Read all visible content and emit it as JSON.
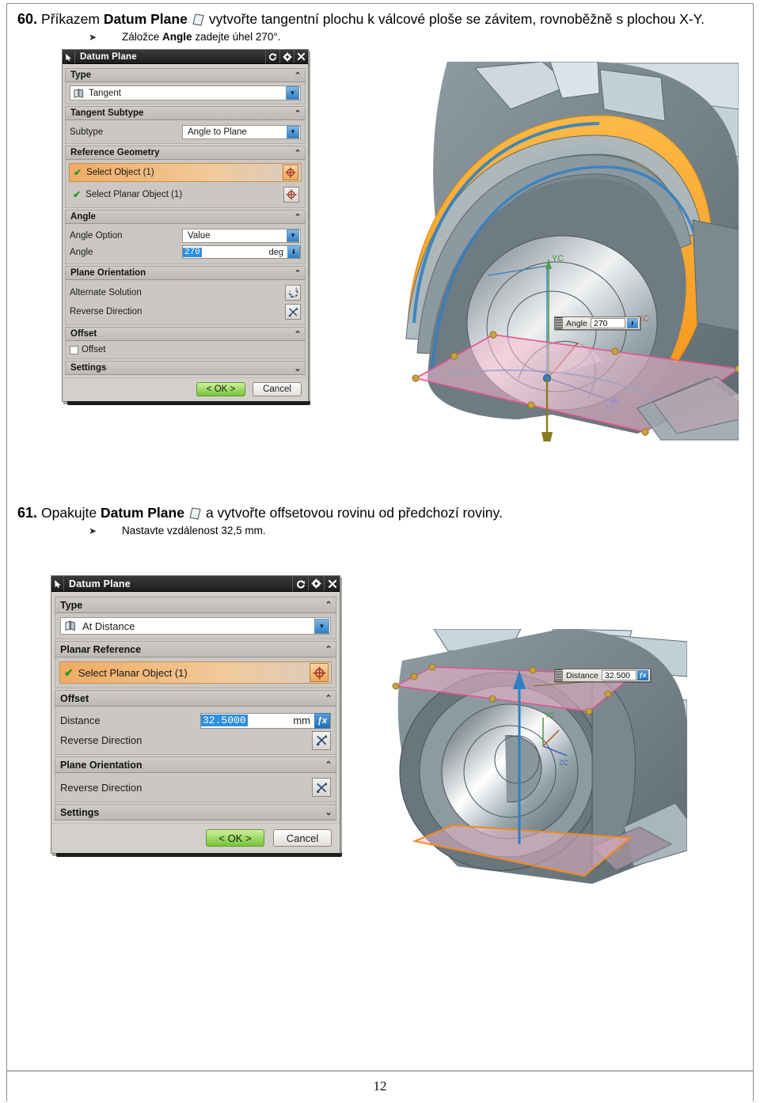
{
  "document": {
    "page_number": "12"
  },
  "steps": [
    {
      "number": "60.",
      "text_before": "Příkazem",
      "command": "Datum Plane",
      "icon": "datum-plane-icon",
      "text_after": "vytvořte tangentní plochu k válcové ploše se závitem, rovnoběžně s plochou X-Y.",
      "sub": {
        "bullet": "➤",
        "before": "Záložce",
        "bold": "Angle",
        "after": "zadejte úhel 270°."
      }
    },
    {
      "number": "61.",
      "text_before": "Opakujte",
      "command": "Datum Plane",
      "icon": "datum-plane-icon",
      "text_after": "a vytvořte offsetovou rovinu od předchozí roviny.",
      "sub": {
        "bullet": "➤",
        "before": "Nastavte vzdálenost 32,5 mm.",
        "bold": "",
        "after": ""
      }
    }
  ],
  "dialog1": {
    "title": "Datum Plane",
    "titlebar_icons": [
      "cursor-icon",
      "reset-icon",
      "gear-icon",
      "close-icon"
    ],
    "groups": [
      {
        "name": "type-group",
        "header": "Type",
        "chevron": "⌃",
        "combo": {
          "label": "Tangent",
          "icon": "plane-icon",
          "arrow": "▼"
        }
      },
      {
        "name": "tangent-subtype-group",
        "header": "Tangent Subtype",
        "chevron": "⌃",
        "row_label": "Subtype",
        "combo": {
          "label": "Angle to Plane",
          "arrow": "▼"
        }
      },
      {
        "name": "reference-geometry-group",
        "header": "Reference Geometry",
        "chevron": "⌃",
        "selections": [
          {
            "label": "Select Object (1)",
            "check": "✔",
            "active": true,
            "icon": "target-icon"
          },
          {
            "label": "Select Planar Object (1)",
            "check": "✔",
            "active": false,
            "icon": "target-icon"
          }
        ]
      },
      {
        "name": "angle-group",
        "header": "Angle",
        "chevron": "⌃",
        "option_label": "Angle Option",
        "option_value": "Value",
        "option_arrow": "▼",
        "angle_label": "Angle",
        "angle_value": "270",
        "angle_unit": "deg",
        "angle_arrow": "⬇"
      },
      {
        "name": "plane-orientation-group",
        "header": "Plane Orientation",
        "chevron": "⌃",
        "rows": [
          {
            "label": "Alternate Solution",
            "icon": "alternate-solution-icon"
          },
          {
            "label": "Reverse Direction",
            "icon": "reverse-direction-icon"
          }
        ]
      },
      {
        "name": "offset-group",
        "header": "Offset",
        "chevron": "⌃",
        "checkbox_label": "Offset",
        "checked": false
      },
      {
        "name": "settings-group",
        "header": "Settings",
        "chevron": "⌄"
      }
    ],
    "buttons": {
      "ok": "< OK >",
      "cancel": "Cancel"
    }
  },
  "dialog2": {
    "title": "Datum Plane",
    "titlebar_icons": [
      "cursor-icon",
      "reset-icon",
      "gear-icon",
      "close-icon"
    ],
    "groups": [
      {
        "name": "type-group",
        "header": "Type",
        "chevron": "⌃",
        "combo": {
          "label": "At Distance",
          "icon": "at-distance-icon",
          "arrow": "▼"
        }
      },
      {
        "name": "planar-reference-group",
        "header": "Planar Reference",
        "chevron": "⌃",
        "selections": [
          {
            "label": "Select Planar Object (1)",
            "check": "✔",
            "active": true,
            "icon": "target-icon"
          }
        ]
      },
      {
        "name": "offset-group",
        "header": "Offset",
        "chevron": "⌃",
        "distance_label": "Distance",
        "distance_value": "32.5000",
        "distance_unit": "mm",
        "fx_label": "f(x)",
        "reverse_label": "Reverse Direction",
        "reverse_icon": "reverse-direction-icon"
      },
      {
        "name": "plane-orientation-group",
        "header": "Plane Orientation",
        "chevron": "⌃",
        "reverse_label": "Reverse Direction",
        "reverse_icon": "reverse-direction-icon"
      },
      {
        "name": "settings-group",
        "header": "Settings",
        "chevron": "⌄"
      }
    ],
    "buttons": {
      "ok": "< OK >",
      "cancel": "Cancel"
    }
  },
  "viewport1": {
    "name": "cad-viewport-tangent-plane",
    "float_input": {
      "label": "Angle",
      "value": "270",
      "arrow": "⬇"
    },
    "axis_labels": {
      "y": "YC",
      "z": "ZC"
    }
  },
  "viewport2": {
    "name": "cad-viewport-offset-plane",
    "float_input": {
      "label": "Distance",
      "value": "32.500",
      "fx": "f(x)"
    }
  },
  "colors": {
    "highlight_orange": "#f0a659",
    "ok_green": "#77c43a",
    "selection_blue": "#2d8fe0",
    "plane_pink": "#f2b8cc",
    "model_gray": "#7d8a91",
    "model_light": "#c6d3d8",
    "tangent_orange": "#f5a623",
    "arc_blue": "#2f7fc4"
  }
}
